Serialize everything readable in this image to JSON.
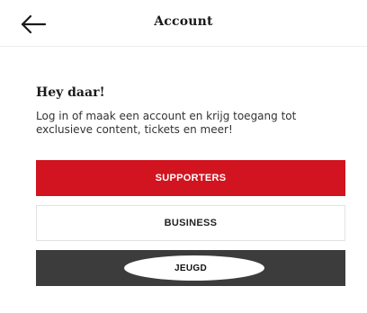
{
  "header": {
    "title": "Account",
    "back_icon": "arrow-left-icon"
  },
  "intro": {
    "greeting": "Hey daar!",
    "message": "Log in of maak een account en krijg toegang tot exclusieve content, tickets en meer!"
  },
  "options": [
    {
      "label": "SUPPORTERS"
    },
    {
      "label": "BUSINESS"
    },
    {
      "label": "JEUGD"
    }
  ],
  "colors": {
    "supporters_bg": "#d1141f",
    "business_bg": "#ffffff",
    "jeugd_bg": "#3c3c3c",
    "text_dark": "#1a1a1a"
  }
}
